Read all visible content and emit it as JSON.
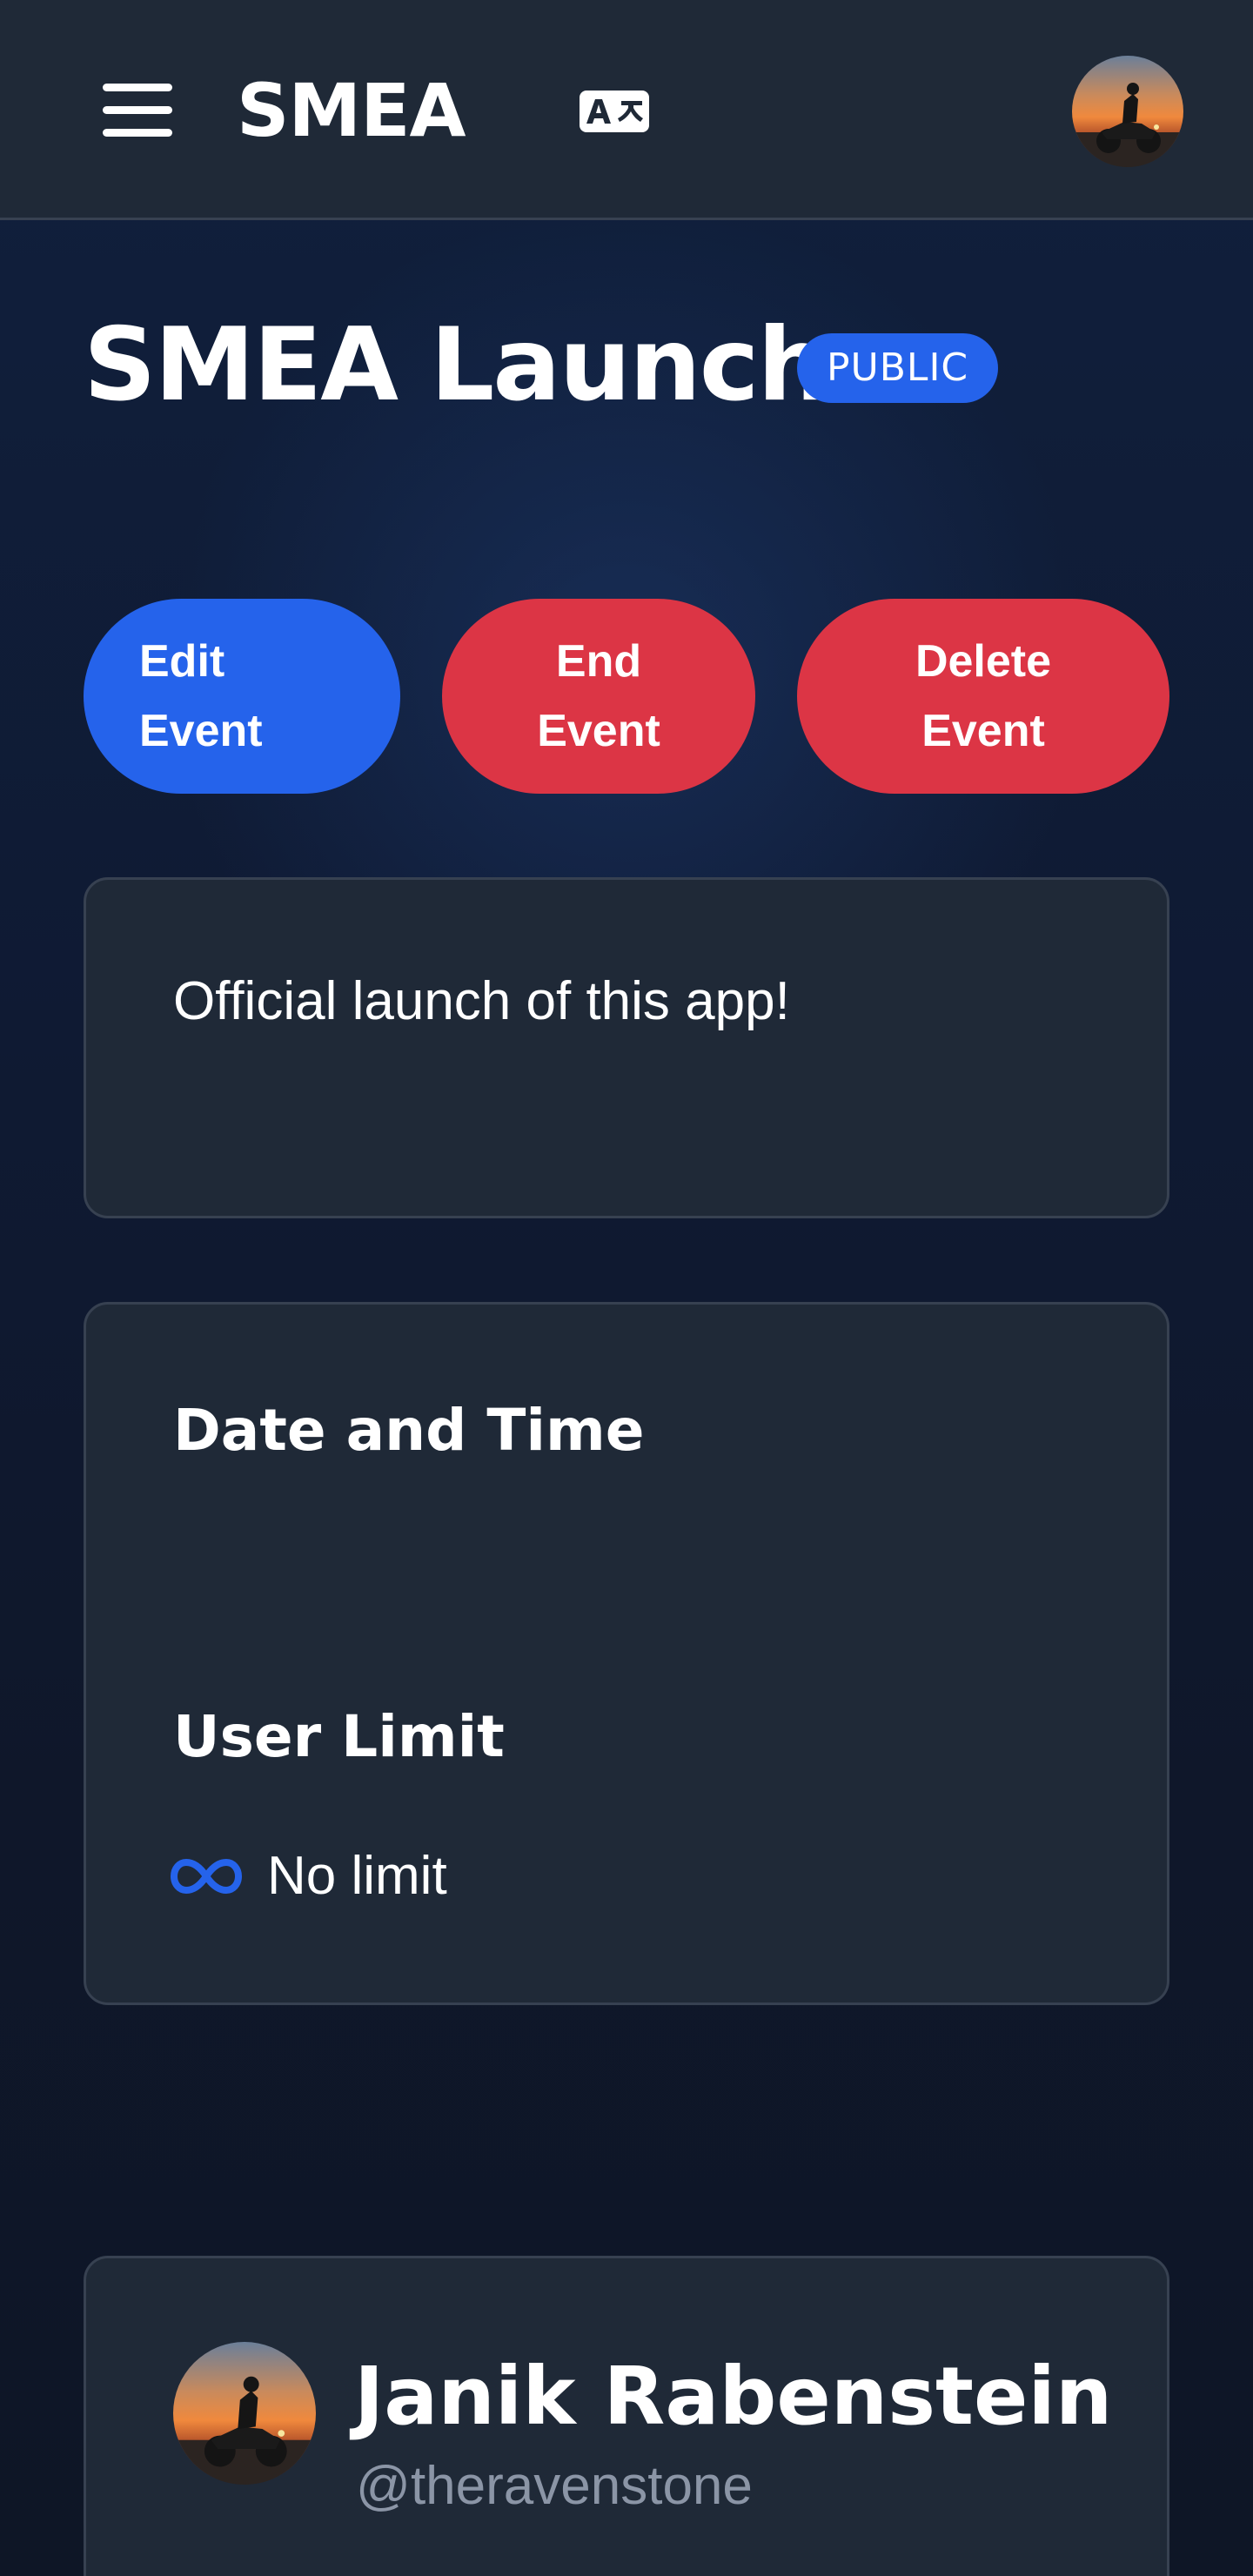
{
  "header": {
    "brand": "SMEA",
    "menu_icon": "hamburger-menu-icon",
    "translate_icon": "translate-icon",
    "avatar_icon": "user-avatar"
  },
  "event": {
    "title": "SMEA Launch",
    "visibility_badge": "PUBLIC",
    "description": "Official launch of this app!"
  },
  "actions": {
    "edit": {
      "line1": "Edit",
      "line2": "Event"
    },
    "end": {
      "line1": "End",
      "line2": "Event"
    },
    "delete": {
      "line1": "Delete",
      "line2": "Event"
    }
  },
  "details": {
    "date_heading": "Date and Time",
    "limit_heading": "User Limit",
    "limit_icon": "infinity-icon",
    "limit_value": "No limit"
  },
  "host": {
    "name": "Janik Rabenstein",
    "handle": "@theravenstone"
  },
  "colors": {
    "primary": "#2563eb",
    "danger": "#dc3545",
    "card_bg": "#1f2937",
    "card_border": "#374151",
    "page_bg": "#0f172a",
    "muted_text": "#8b95a6"
  }
}
